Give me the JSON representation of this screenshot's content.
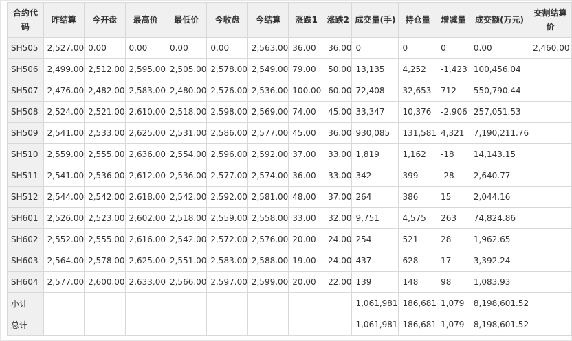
{
  "headers": [
    "合约代码",
    "昨结算",
    "今开盘",
    "最高价",
    "最低价",
    "今收盘",
    "今结算",
    "涨跌1",
    "涨跌2",
    "成交量(手)",
    "持仓量",
    "增减量",
    "成交额(万元)",
    "交割结算价"
  ],
  "rows": [
    [
      "SH505",
      "2,527.00",
      "0.00",
      "0.00",
      "0.00",
      "0.00",
      "2,563.00",
      "36.00",
      "36.00",
      "0",
      "0",
      "0",
      "0.00",
      "2,460.00"
    ],
    [
      "SH506",
      "2,499.00",
      "2,512.00",
      "2,595.00",
      "2,505.00",
      "2,578.00",
      "2,549.00",
      "79.00",
      "50.00",
      "13,135",
      "4,252",
      "-1,423",
      "100,456.04",
      ""
    ],
    [
      "SH507",
      "2,476.00",
      "2,482.00",
      "2,583.00",
      "2,480.00",
      "2,576.00",
      "2,536.00",
      "100.00",
      "60.00",
      "72,408",
      "32,653",
      "712",
      "550,790.44",
      ""
    ],
    [
      "SH508",
      "2,524.00",
      "2,521.00",
      "2,610.00",
      "2,518.00",
      "2,598.00",
      "2,569.00",
      "74.00",
      "45.00",
      "33,347",
      "10,376",
      "-2,906",
      "257,051.53",
      ""
    ],
    [
      "SH509",
      "2,541.00",
      "2,533.00",
      "2,625.00",
      "2,531.00",
      "2,586.00",
      "2,577.00",
      "45.00",
      "36.00",
      "930,085",
      "131,581",
      "4,321",
      "7,190,211.76",
      ""
    ],
    [
      "SH510",
      "2,559.00",
      "2,555.00",
      "2,636.00",
      "2,554.00",
      "2,596.00",
      "2,592.00",
      "37.00",
      "33.00",
      "1,819",
      "1,162",
      "-18",
      "14,143.15",
      ""
    ],
    [
      "SH511",
      "2,541.00",
      "2,536.00",
      "2,612.00",
      "2,536.00",
      "2,577.00",
      "2,574.00",
      "36.00",
      "33.00",
      "342",
      "399",
      "-28",
      "2,640.77",
      ""
    ],
    [
      "SH512",
      "2,544.00",
      "2,542.00",
      "2,618.00",
      "2,542.00",
      "2,592.00",
      "2,581.00",
      "48.00",
      "37.00",
      "264",
      "386",
      "15",
      "2,044.16",
      ""
    ],
    [
      "SH601",
      "2,526.00",
      "2,523.00",
      "2,602.00",
      "2,518.00",
      "2,559.00",
      "2,558.00",
      "33.00",
      "32.00",
      "9,751",
      "4,575",
      "263",
      "74,824.86",
      ""
    ],
    [
      "SH602",
      "2,552.00",
      "2,555.00",
      "2,616.00",
      "2,542.00",
      "2,572.00",
      "2,576.00",
      "20.00",
      "24.00",
      "254",
      "521",
      "28",
      "1,962.65",
      ""
    ],
    [
      "SH603",
      "2,564.00",
      "2,578.00",
      "2,625.00",
      "2,551.00",
      "2,583.00",
      "2,588.00",
      "19.00",
      "24.00",
      "437",
      "628",
      "17",
      "3,392.24",
      ""
    ],
    [
      "SH604",
      "2,577.00",
      "2,600.00",
      "2,633.00",
      "2,566.00",
      "2,597.00",
      "2,599.00",
      "20.00",
      "22.00",
      "139",
      "148",
      "98",
      "1,083.93",
      ""
    ]
  ],
  "summary": [
    [
      "小计",
      "",
      "",
      "",
      "",
      "",
      "",
      "",
      "",
      "1,061,981",
      "186,681",
      "1,079",
      "8,198,601.52",
      ""
    ],
    [
      "总计",
      "",
      "",
      "",
      "",
      "",
      "",
      "",
      "",
      "1,061,981",
      "186,681",
      "1,079",
      "8,198,601.52",
      ""
    ]
  ]
}
